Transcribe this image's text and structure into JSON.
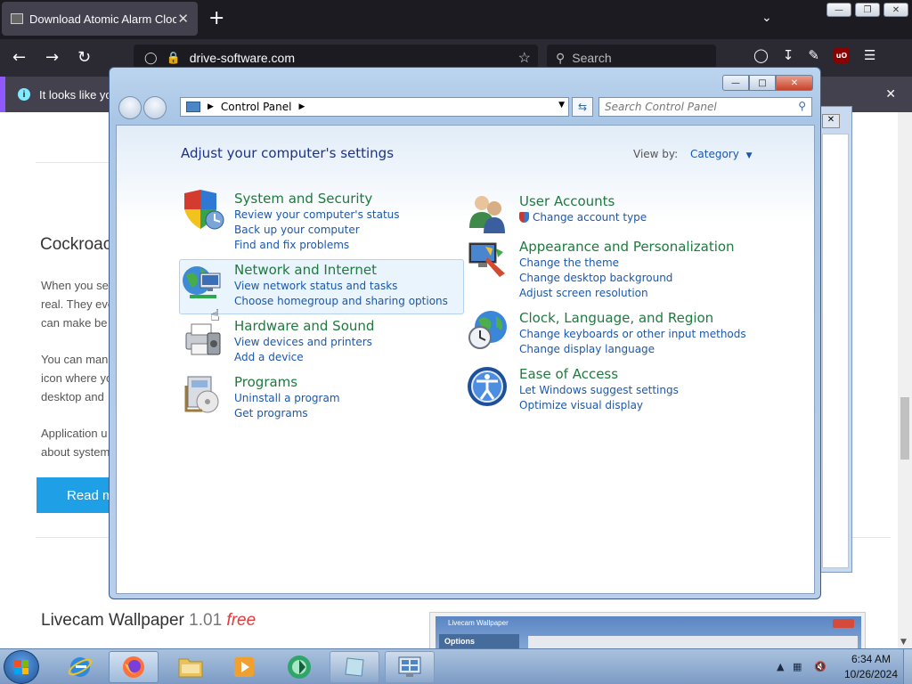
{
  "browser": {
    "tab_title": "Download Atomic Alarm Clock",
    "tab_close": "✕",
    "new_tab": "+",
    "url": "drive-software.com",
    "search_placeholder": "Search",
    "notification": "It looks like you",
    "notification_close": "✕"
  },
  "page": {
    "article_title": "Cockroac",
    "paragraphs": [
      [
        "When you se",
        "real. They eve",
        "can make be"
      ],
      [
        "You can mana",
        "icon where yo",
        "desktop and"
      ],
      [
        "Application u",
        "about system"
      ]
    ],
    "read_more": "Read m",
    "next_title": "Livecam Wallpaper",
    "next_version": "1.01",
    "next_price": "free",
    "thumb_title": "Livecam Wallpaper",
    "thumb_options": "Options"
  },
  "control_panel": {
    "address": "Control Panel",
    "search_placeholder": "Search Control Panel",
    "heading": "Adjust your computer's settings",
    "view_by_label": "View by:",
    "view_by_value": "Category",
    "categories": [
      {
        "title": "System and Security",
        "icon": "shield-icon",
        "links": [
          "Review your computer's status",
          "Back up your computer",
          "Find and fix problems"
        ]
      },
      {
        "title": "Network and Internet",
        "icon": "network-globe-icon",
        "links": [
          "View network status and tasks",
          "Choose homegroup and sharing options"
        ]
      },
      {
        "title": "Hardware and Sound",
        "icon": "printer-icon",
        "links": [
          "View devices and printers",
          "Add a device"
        ]
      },
      {
        "title": "Programs",
        "icon": "programs-icon",
        "links": [
          "Uninstall a program",
          "Get programs"
        ]
      },
      {
        "title": "User Accounts",
        "icon": "users-icon",
        "links": [
          "Change account type"
        ]
      },
      {
        "title": "Appearance and Personalization",
        "icon": "monitor-paint-icon",
        "links": [
          "Change the theme",
          "Change desktop background",
          "Adjust screen resolution"
        ]
      },
      {
        "title": "Clock, Language, and Region",
        "icon": "clock-globe-icon",
        "links": [
          "Change keyboards or other input methods",
          "Change display language"
        ]
      },
      {
        "title": "Ease of Access",
        "icon": "ease-of-access-icon",
        "links": [
          "Let Windows suggest settings",
          "Optimize visual display"
        ]
      }
    ]
  },
  "taskbar": {
    "time": "6:34 AM",
    "date": "10/26/2024",
    "items": [
      "internet-explorer",
      "firefox",
      "file-explorer",
      "media-player",
      "app-green",
      "app-window",
      "control-panel"
    ]
  },
  "colors": {
    "link": "#1c57ad",
    "category_title": "#1e7a3e",
    "heading": "#1e3287",
    "read_button": "#1e9fe6",
    "free": "#e03b3b"
  }
}
